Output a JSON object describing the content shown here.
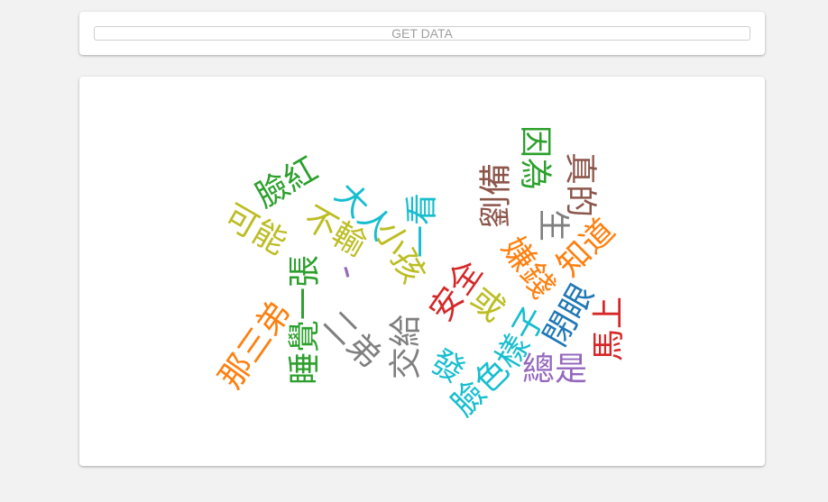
{
  "toolbar": {
    "get_data_label": "GET DATA"
  },
  "cloud": {
    "words": [
      {
        "text": "臉紅",
        "color": "#2ca02c"
      },
      {
        "text": "可能",
        "color": "#bcbd22"
      },
      {
        "text": "大人",
        "color": "#17becf"
      },
      {
        "text": "不輸",
        "color": "#bcbd22"
      },
      {
        "text": "、",
        "color": "#9467bd"
      },
      {
        "text": "小孩",
        "color": "#bcbd22"
      },
      {
        "text": "一看",
        "color": "#17becf"
      },
      {
        "text": "劉備",
        "color": "#8c564b"
      },
      {
        "text": "因為",
        "color": "#2ca02c"
      },
      {
        "text": "真的",
        "color": "#8c564b"
      },
      {
        "text": "生",
        "color": "#7f7f7f"
      },
      {
        "text": "知道",
        "color": "#ff7f0e"
      },
      {
        "text": "安全",
        "color": "#d62728"
      },
      {
        "text": "嫌錢",
        "color": "#ff7f0e"
      },
      {
        "text": "或",
        "color": "#bcbd22"
      },
      {
        "text": "閉眼",
        "color": "#1f77b4"
      },
      {
        "text": "樣子",
        "color": "#17becf"
      },
      {
        "text": "馬上",
        "color": "#d62728"
      },
      {
        "text": "那三弟",
        "color": "#ff7f0e"
      },
      {
        "text": "睡覺一張",
        "color": "#2ca02c"
      },
      {
        "text": "二弟",
        "color": "#7f7f7f"
      },
      {
        "text": "交給",
        "color": "#7f7f7f"
      },
      {
        "text": "發",
        "color": "#17becf"
      },
      {
        "text": "臉色",
        "color": "#17becf"
      },
      {
        "text": "總是",
        "color": "#9467bd"
      }
    ]
  }
}
